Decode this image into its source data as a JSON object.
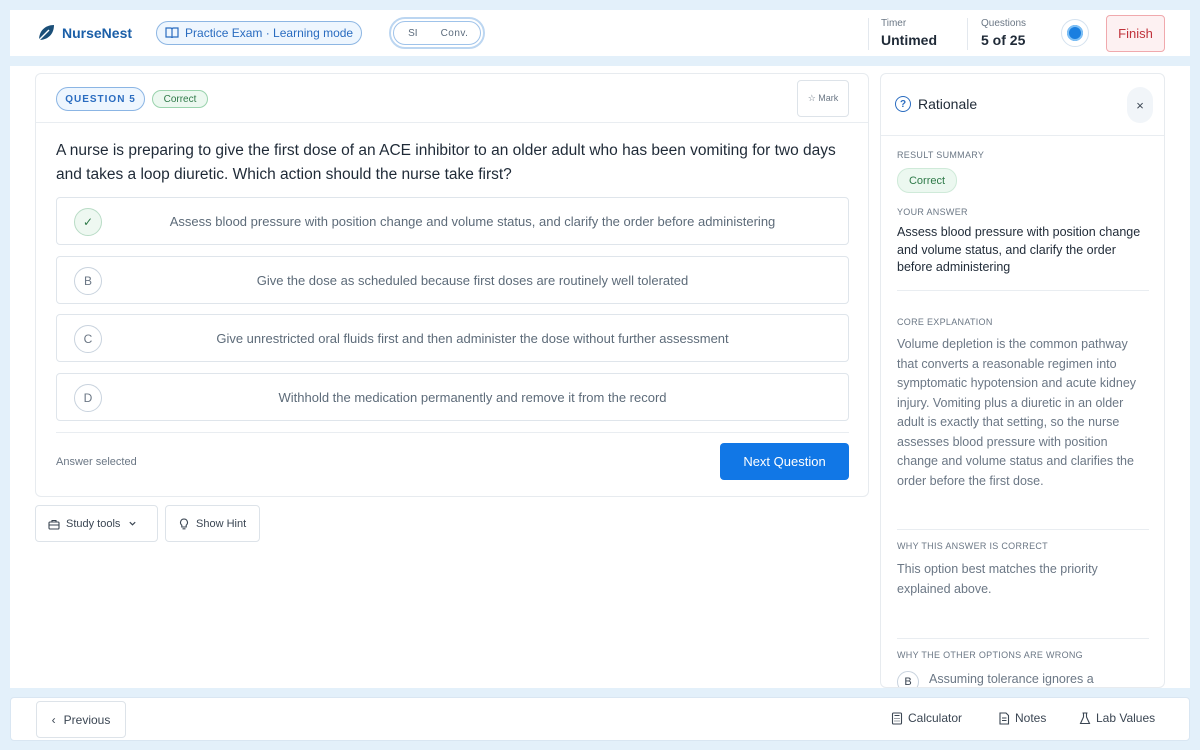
{
  "app": {
    "name": "NurseNest",
    "mode_badge": "Practice Exam · Learning mode",
    "view_toggle": {
      "option1": "SI",
      "option2": "Conv."
    }
  },
  "header": {
    "timer_label": "Timer",
    "timer_value": "Untimed",
    "questions_label": "Questions",
    "questions_value": "5 of 25",
    "finish_label": "Finish"
  },
  "question": {
    "number_label": "QUESTION 5",
    "status_badge": "Correct",
    "mark_label": "☆ Mark",
    "text": "A nurse is preparing to give the first dose of an ACE inhibitor to an older adult who has been vomiting for two days and takes a loop diuretic. Which action should the nurse take first?",
    "options": [
      {
        "letter": "✓",
        "text": "Assess blood pressure with position change and volume status, and clarify the order before administering"
      },
      {
        "letter": "B",
        "text": "Give the dose as scheduled because first doses are routinely well tolerated"
      },
      {
        "letter": "C",
        "text": "Give unrestricted oral fluids first and then administer the dose without further assessment"
      },
      {
        "letter": "D",
        "text": "Withhold the medication permanently and remove it from the record"
      }
    ],
    "answer_status": "Answer selected",
    "next_label": "Next Question"
  },
  "tools": {
    "study_tools_label": "Study tools",
    "show_hint_label": "Show Hint"
  },
  "rationale": {
    "title": "Rationale",
    "close_label": "×",
    "result_summary_label": "RESULT SUMMARY",
    "result_value": "Correct",
    "your_answer_label": "YOUR ANSWER",
    "your_answer_text": "Assess blood pressure with position change and volume status, and clarify the order before administering",
    "core_label": "CORE EXPLANATION",
    "core_text": "Volume depletion is the common pathway that converts a reasonable regimen into symptomatic hypotension and acute kidney injury. Vomiting plus a diuretic in an older adult is exactly that setting, so the nurse assesses blood pressure with position change and volume status and clarifies the order before the first dose.",
    "why_correct_label": "WHY THIS ANSWER IS CORRECT",
    "why_correct_text": "This option best matches the priority explained above.",
    "why_wrong_label": "WHY THE OTHER OPTIONS ARE WRONG",
    "wrong_letter": "B",
    "wrong_text": "Assuming tolerance ignores a"
  },
  "footer": {
    "previous_label": "Previous",
    "calculator_label": "Calculator",
    "notes_label": "Notes",
    "lab_values_label": "Lab Values"
  },
  "colors": {
    "primary": "#1177e6",
    "brand": "#1b5fa8",
    "correct": "#2f7a49",
    "finish": "#c0323b"
  },
  "icons": [
    "leaf-logo-icon",
    "book-icon",
    "progress-ring-icon",
    "star-icon",
    "check-icon",
    "toolbox-icon",
    "chevron-down-icon",
    "lightbulb-icon",
    "help-circle-icon",
    "close-icon",
    "chevron-left-icon",
    "calculator-icon",
    "notes-icon",
    "flask-icon"
  ]
}
